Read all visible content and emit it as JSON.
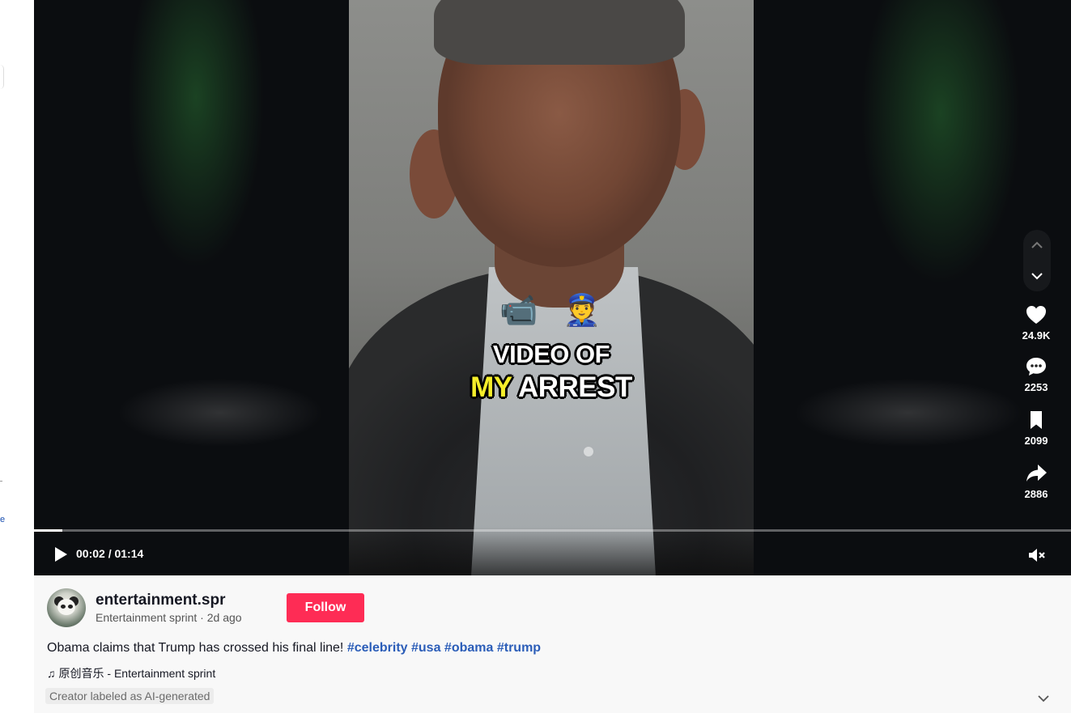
{
  "player": {
    "caption_emojis": [
      "📹",
      "👮"
    ],
    "caption_line1": "VIDEO OF",
    "caption_line2_highlight": "MY",
    "caption_line2_rest": "ARREST",
    "progress_fraction": 0.027,
    "time_display": "00:02 / 01:14"
  },
  "actions": {
    "likes": "24.9K",
    "comments": "2253",
    "saves": "2099",
    "shares": "2886"
  },
  "post": {
    "username": "entertainment.spr",
    "nickname": "Entertainment sprint",
    "separator": " · ",
    "posted_ago": "2d ago",
    "follow_label": "Follow",
    "description": "Obama claims that Trump has crossed his final line!",
    "hashtags": [
      "#celebrity",
      "#usa",
      "#obama",
      "#trump"
    ],
    "music_icon": "♫",
    "music": "原创音乐 - Entertainment sprint",
    "ai_label": "Creator labeled as AI-generated"
  },
  "colors": {
    "follow_bg": "#fe2c55",
    "hashtag": "#2b5db8",
    "highlight": "#f5ee2a"
  },
  "left_rail_fragment": "e"
}
